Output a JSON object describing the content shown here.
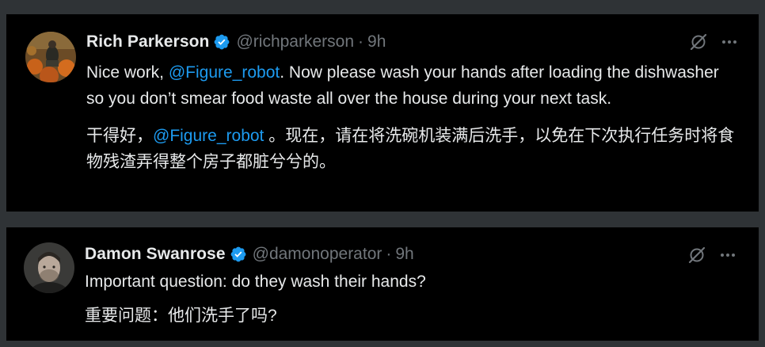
{
  "tweets": [
    {
      "author_name": "Rich Parkerson",
      "handle": "@richparkerson",
      "separator": "·",
      "time": "9h",
      "verified": true,
      "en": {
        "before": "Nice work, ",
        "mention": "@Figure_robot",
        "after": ".  Now please wash your hands after loading the dishwasher so you don’t smear food waste all over the house during your next task."
      },
      "zh": {
        "before": "干得好，",
        "mention": "@Figure_robot",
        "after": " 。现在，请在将洗碗机装满后洗手，以免在下次执行任务时将食物残渣弄得整个房子都脏兮兮的。"
      }
    },
    {
      "author_name": "Damon Swanrose",
      "handle": "@damonoperator",
      "separator": "·",
      "time": "9h",
      "verified": true,
      "en": {
        "text": "Important question: do they wash their hands?"
      },
      "zh": {
        "text": "重要问题：他们洗手了吗?"
      }
    }
  ],
  "icons": {
    "verified": "verified-badge-icon",
    "grok": "grok-icon",
    "more": "more-options-icon"
  },
  "colors": {
    "background": "#000000",
    "separator": "#2f3336",
    "text": "#e7e9ea",
    "muted": "#71767b",
    "link": "#1d9bf0",
    "verified": "#1d9bf0"
  }
}
